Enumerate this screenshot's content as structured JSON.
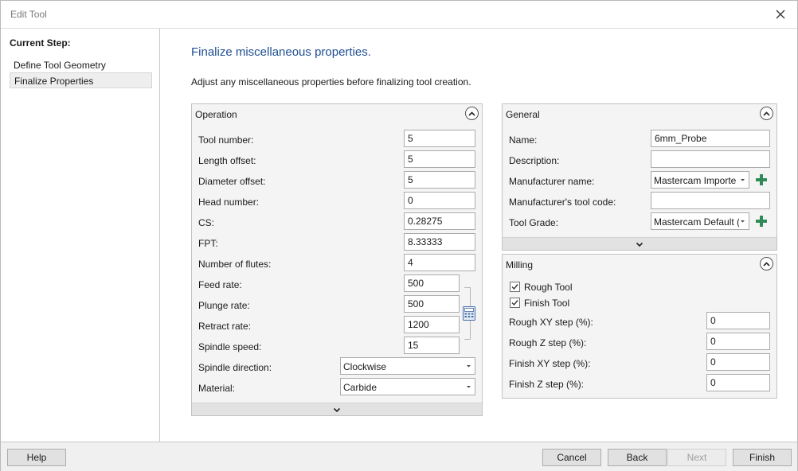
{
  "window": {
    "title": "Edit Tool"
  },
  "steps": {
    "heading": "Current Step:",
    "items": [
      {
        "label": "Define Tool Geometry",
        "selected": false
      },
      {
        "label": "Finalize Properties",
        "selected": true
      }
    ]
  },
  "main": {
    "heading": "Finalize miscellaneous properties.",
    "description": "Adjust any miscellaneous properties before finalizing tool creation."
  },
  "operation": {
    "title": "Operation",
    "tool_number": {
      "label": "Tool number:",
      "value": "5"
    },
    "length_offset": {
      "label": "Length offset:",
      "value": "5"
    },
    "diameter_offset": {
      "label": "Diameter offset:",
      "value": "5"
    },
    "head_number": {
      "label": "Head number:",
      "value": "0"
    },
    "cs": {
      "label": "CS:",
      "value": "0.28275"
    },
    "fpt": {
      "label": "FPT:",
      "value": "8.33333"
    },
    "number_of_flutes": {
      "label": "Number of flutes:",
      "value": "4"
    },
    "feed_rate": {
      "label": "Feed rate:",
      "value": "500"
    },
    "plunge_rate": {
      "label": "Plunge rate:",
      "value": "500"
    },
    "retract_rate": {
      "label": "Retract rate:",
      "value": "1200"
    },
    "spindle_speed": {
      "label": "Spindle speed:",
      "value": "15"
    },
    "spindle_direction": {
      "label": "Spindle direction:",
      "value": "Clockwise"
    },
    "material": {
      "label": "Material:",
      "value": "Carbide"
    }
  },
  "general": {
    "title": "General",
    "name": {
      "label": "Name:",
      "value": "6mm_Probe"
    },
    "description": {
      "label": "Description:",
      "value": ""
    },
    "manufacturer_name": {
      "label": "Manufacturer name:",
      "value": "Mastercam Importe"
    },
    "manufacturer_tool_code": {
      "label": "Manufacturer's tool code:",
      "value": ""
    },
    "tool_grade": {
      "label": "Tool Grade:",
      "value": "Mastercam Default ("
    }
  },
  "milling": {
    "title": "Milling",
    "rough_tool": {
      "label": "Rough Tool",
      "checked": true
    },
    "finish_tool": {
      "label": "Finish Tool",
      "checked": true
    },
    "rough_xy_step": {
      "label": "Rough XY step (%):",
      "value": "0"
    },
    "rough_z_step": {
      "label": "Rough Z step (%):",
      "value": "0"
    },
    "finish_xy_step": {
      "label": "Finish XY step (%):",
      "value": "0"
    },
    "finish_z_step": {
      "label": "Finish Z step (%):",
      "value": "0"
    }
  },
  "footer": {
    "help": "Help",
    "cancel": "Cancel",
    "back": "Back",
    "next": "Next",
    "finish": "Finish"
  },
  "colors": {
    "heading": "#1f4f92",
    "plus_icon": "#2e8b57"
  }
}
